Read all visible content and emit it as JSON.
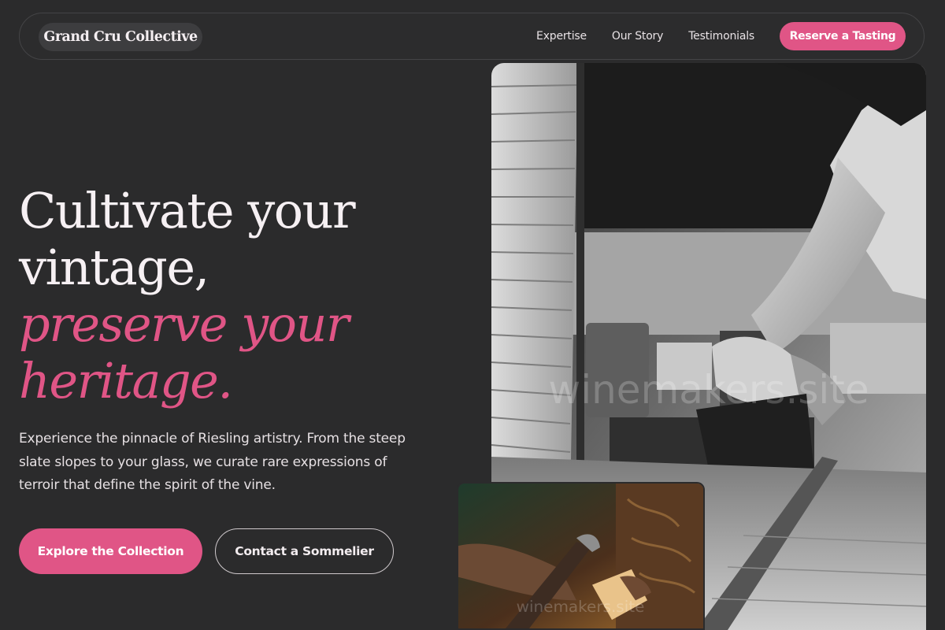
{
  "nav": {
    "brand": "Grand Cru Collective",
    "links": [
      "Expertise",
      "Our Story",
      "Testimonials"
    ],
    "cta": "Reserve a Tasting"
  },
  "hero": {
    "headline_line1": "Cultivate your vintage,",
    "headline_line2": "preserve your heritage.",
    "description": "Experience the pinnacle of Riesling artistry. From the steep slate slopes to your glass, we curate rare expressions of terroir that define the spirit of the vine.",
    "primary_button": "Explore the Collection",
    "secondary_button": "Contact a Sommelier"
  },
  "images": {
    "main_watermark": "winemakers.site",
    "small_watermark": "winemakers.site"
  },
  "colors": {
    "background": "#2b2b2c",
    "accent": "#e05586",
    "text": "#f6f0f3"
  }
}
